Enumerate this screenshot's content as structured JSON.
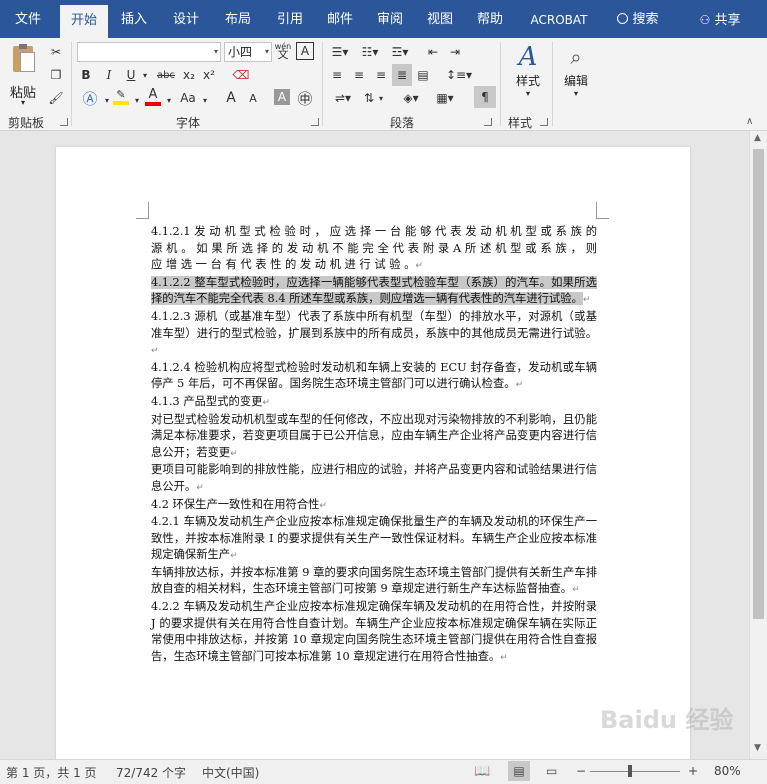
{
  "tabs": [
    "文件",
    "开始",
    "插入",
    "设计",
    "布局",
    "引用",
    "邮件",
    "审阅",
    "视图",
    "帮助",
    "ACROBAT"
  ],
  "search_label": "搜索",
  "share_label": "共享",
  "ribbon": {
    "paste_label": "粘贴",
    "clipboard_label": "剪贴板",
    "font_label": "字体",
    "paragraph_label": "段落",
    "styles_label": "样式",
    "styles_group_label": "样式",
    "editing_label": "编辑",
    "font_name": "",
    "font_size": "小四",
    "wen_label": "wén",
    "a_label": "A",
    "bold": "B",
    "italic": "I",
    "underline": "U",
    "strike": "abc",
    "sub": "x₂",
    "sup": "x²",
    "aa": "Aa",
    "grow": "A",
    "shrink": "A"
  },
  "document": {
    "paragraphs": [
      {
        "text": "4.1.2.1 发 动 机 型 式 检 验 时 ， 应 选 择 一 台 能 够 代 表 发 动 机 机 型 或 系 族 的 源 机 。 如 果 所 选 择 的 发 动 机 不 能 完 全 代 表 附 录 A 所 述 机 型 或 系 族 ， 则 应 增 选 一 台 有 代 表 性 的 发 动 机 进 行 试 验 。",
        "prefix": "",
        "highlight": false
      },
      {
        "text": "整车型式检验时，应选择一辆能够代表型式检验车型（系族）的汽车。如果所选择的汽车不能完全代表 8.4 所述车型或系族，则应增选一辆有代表性的汽车进行试验。",
        "prefix": "4.1.2.2 ",
        "highlight": true
      },
      {
        "text": "4.1.2.3 源机（或基准车型）代表了系族中所有机型（车型）的排放水平，对源机（或基准车型）进行的型式检验，扩展到系族中的所有成员，系族中的其他成员无需进行试验。",
        "prefix": "",
        "highlight": false
      },
      {
        "text": "4.1.2.4 检验机构应将型式检验时发动机和车辆上安装的 ECU 封存备查，发动机或车辆停产 5 年后，可不再保留。国务院生态环境主管部门可以进行确认检查。",
        "prefix": "",
        "highlight": false
      },
      {
        "text": "4.1.3 产品型式的变更",
        "prefix": "",
        "highlight": false
      },
      {
        "text": "对已型式检验发动机机型或车型的任何修改，不应出现对污染物排放的不利影响，且仍能满足本标准要求，若变更项目属于已公开信息，应由车辆生产企业将产品变更内容进行信息公开；若变更",
        "prefix": "",
        "highlight": false
      },
      {
        "text": "更项目可能影响到的排放性能，应进行相应的试验，并将产品变更内容和试验结果进行信息公开。",
        "prefix": "",
        "highlight": false
      },
      {
        "text": "4.2 环保生产一致性和在用符合性",
        "prefix": "",
        "highlight": false
      },
      {
        "text": "4.2.1 车辆及发动机生产企业应按本标准规定确保批量生产的车辆及发动机的环保生产一致性，并按本标准附录 I 的要求提供有关生产一致性保证材料。车辆生产企业应按本标准规定确保新生产",
        "prefix": "",
        "highlight": false
      },
      {
        "text": "车辆排放达标，并按本标准第 9 章的要求向国务院生态环境主管部门提供有关新生产车排放自查的相关材料，生态环境主管部门可按第 9 章规定进行新生产车达标监督抽查。",
        "prefix": "",
        "highlight": false
      },
      {
        "text": "4.2.2 车辆及发动机生产企业应按本标准规定确保车辆及发动机的在用符合性，并按附录 J 的要求提供有关在用符合性自查计划。车辆生产企业应按本标准规定确保车辆在实际正常使用中排放达标，并按第 10 章规定向国务院生态环境主管部门提供在用符合性自查报告，生态环境主管部门可按本标准第 10 章规定进行在用符合性抽查。",
        "prefix": "",
        "highlight": false
      }
    ]
  },
  "status": {
    "page": "第 1 页，共 1 页",
    "words": "72/742 个字",
    "lang": "中文(中国)",
    "zoom": "80%",
    "minus": "−",
    "plus": "+"
  },
  "watermark": "Baidu 经验",
  "colors": {
    "accent": "#2b579a",
    "highlight": "#c8c8c8"
  }
}
